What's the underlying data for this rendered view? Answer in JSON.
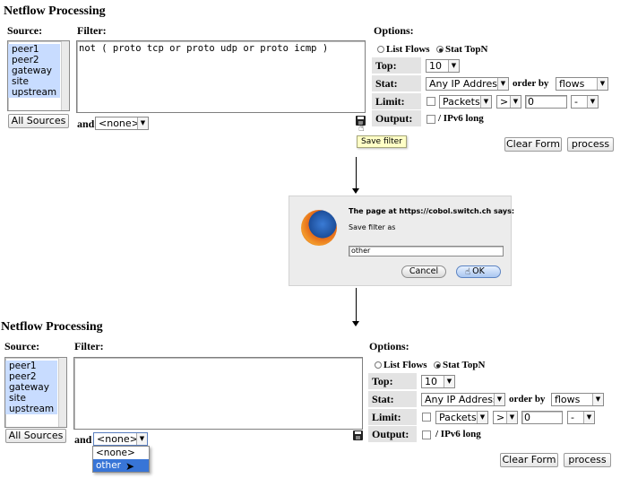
{
  "title": "Netflow Processing",
  "labels": {
    "source": "Source:",
    "filter": "Filter:",
    "options": "Options:",
    "and": "and",
    "top": "Top:",
    "stat": "Stat:",
    "limit": "Limit:",
    "output": "Output:",
    "order_by": "order by",
    "ipv6": "/ IPv6 long"
  },
  "sources": [
    "peer1",
    "peer2",
    "gateway",
    "site",
    "upstream"
  ],
  "buttons": {
    "all_sources": "All Sources",
    "clear_form": "Clear Form",
    "process": "process"
  },
  "modes": {
    "list_flows": "List Flows",
    "stat_topn": "Stat TopN",
    "selected": "stat_topn"
  },
  "top1": {
    "filter_text": "not ( proto tcp or proto udp or proto icmp )",
    "and_select": "<none>",
    "tooltip": "Save filter"
  },
  "options_values": {
    "top": "10",
    "stat": "Any IP Address",
    "order_by": "flows",
    "limit_type": "Packets",
    "limit_op": ">",
    "limit_value": "0",
    "limit_unit": "-"
  },
  "dialog": {
    "message": "The page at https://cobol.switch.ch says:",
    "prompt": "Save filter as",
    "input_value": "other",
    "cancel": "Cancel",
    "ok": "OK"
  },
  "bottom": {
    "filter_text": "",
    "and_select": "<none>",
    "dropdown_options": [
      "<none>",
      "other"
    ],
    "highlighted": "other"
  },
  "colors": {
    "list_highlight": "#c8dcff",
    "option_label_bg": "#e3e3e3",
    "dropdown_highlight": "#3875d7",
    "dialog_bg": "#ececec",
    "tooltip_bg": "#ffffc6"
  }
}
